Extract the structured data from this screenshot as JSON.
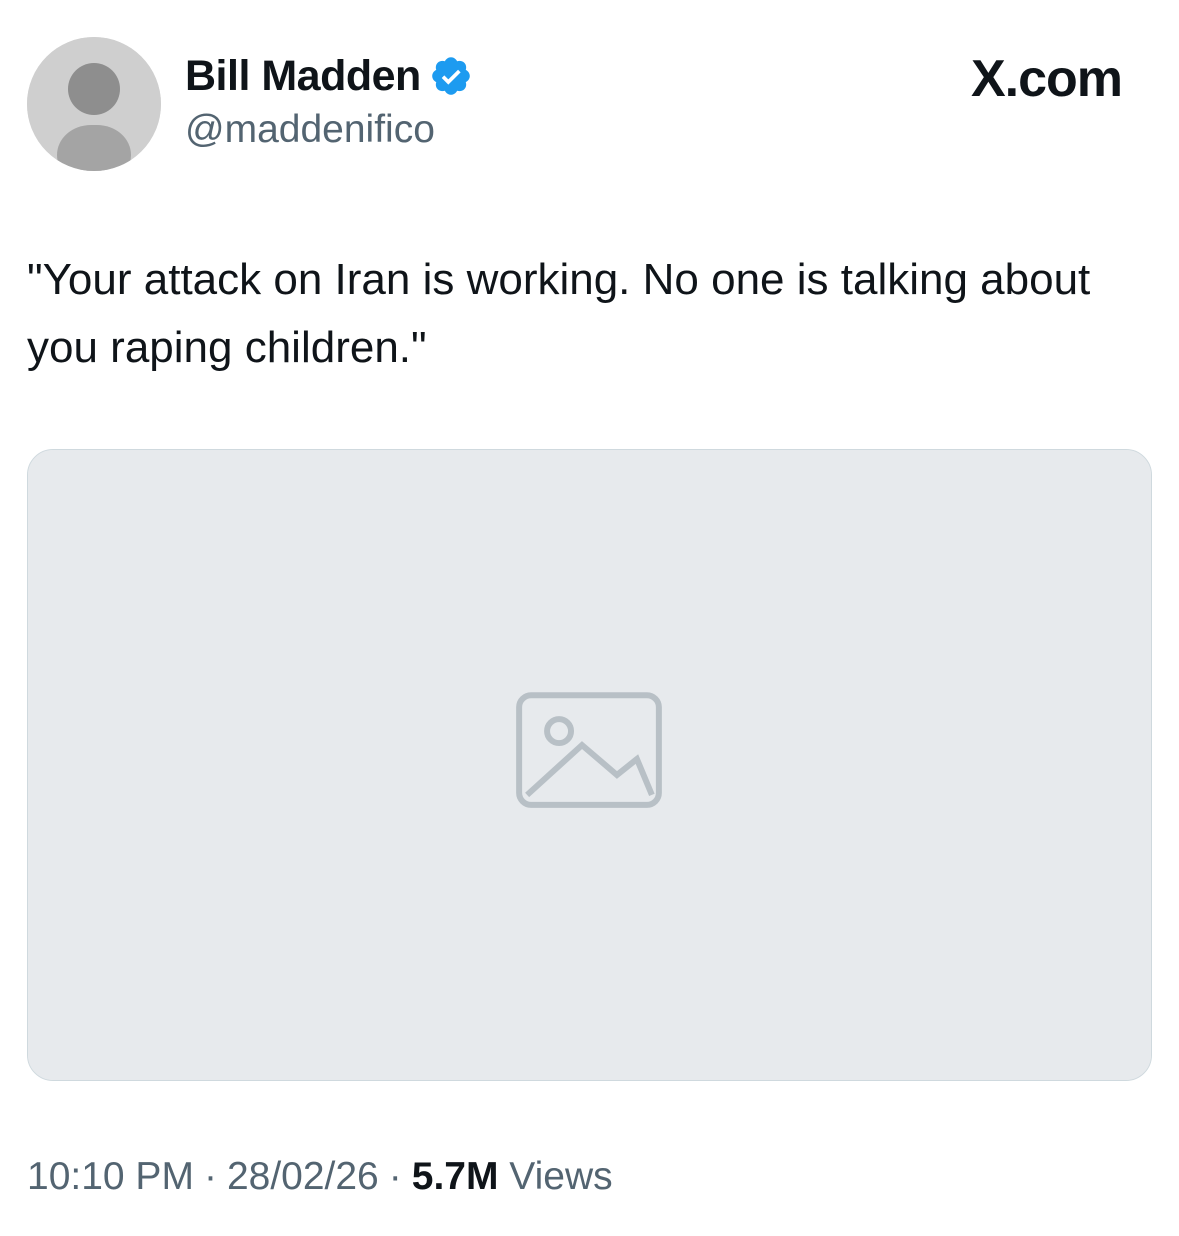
{
  "author": {
    "display_name": "Bill Madden",
    "handle": "@maddenifico",
    "verified": true,
    "avatar_icon": "profile-photo",
    "verified_icon": "verified-badge-icon"
  },
  "site_label": "X.com",
  "tweet": {
    "text": "\"Your attack on Iran is working. No one is talking about you raping children.\""
  },
  "media": {
    "type": "photo",
    "icon": "photo-placeholder"
  },
  "meta": {
    "time": "10:10 PM",
    "separator": "·",
    "date": "28/02/26",
    "views_count": "5.7M",
    "views_label": "Views"
  },
  "colors": {
    "text_primary": "#0f1419",
    "text_secondary": "#536471",
    "verified_blue": "#1d9bf0",
    "border": "#cfd9de"
  }
}
